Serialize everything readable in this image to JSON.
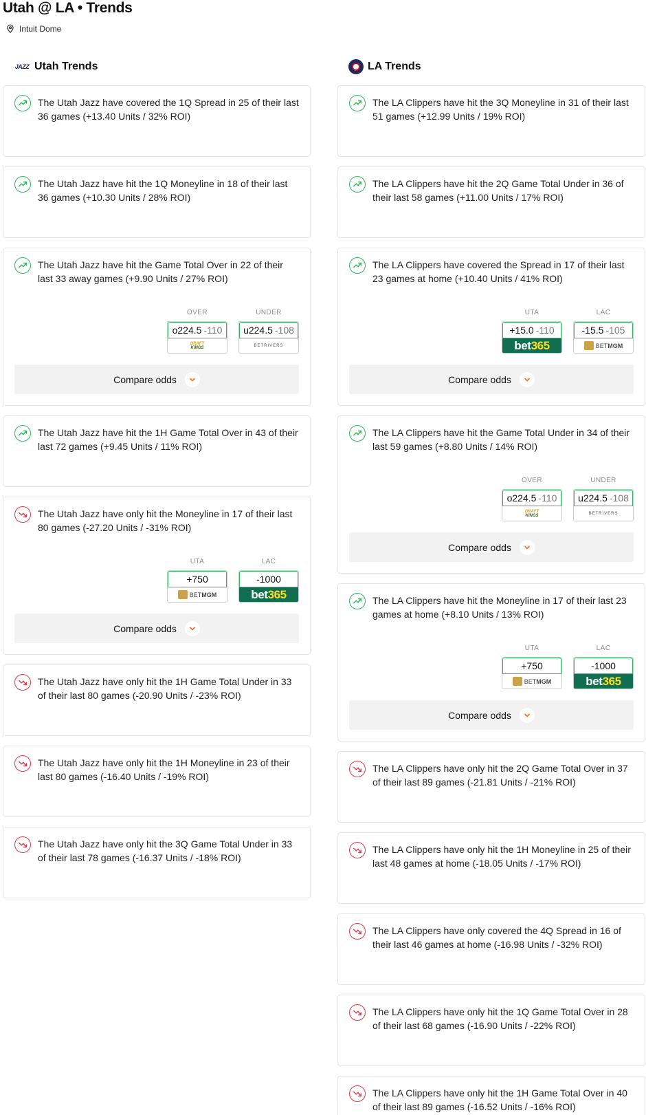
{
  "header": {
    "title": "Utah @ LA • Trends",
    "venue": "Intuit Dome",
    "venue_icon": "location-pin-icon"
  },
  "colors": {
    "up": "#2fb660",
    "down": "#e0394a",
    "accent": "#f26b21"
  },
  "compare_label": "Compare odds",
  "utah": {
    "heading": "Utah Trends",
    "logo_text": "JAZZ",
    "cards": [
      {
        "dir": "up",
        "text": "The Utah Jazz have covered the 1Q Spread in 25 of their last 36 games (+13.40 Units / 32% ROI)"
      },
      {
        "dir": "up",
        "text": "The Utah Jazz have hit the 1Q Moneyline in 18 of their last 36 games (+10.30 Units / 28% ROI)"
      },
      {
        "dir": "up",
        "text": "The Utah Jazz have hit the Game Total Over in 22 of their last 33 away games (+9.90 Units / 27% ROI)",
        "odds": [
          {
            "label": "OVER",
            "line": "o224.5",
            "price": "-110",
            "book": "DraftKings"
          },
          {
            "label": "UNDER",
            "line": "u224.5",
            "price": "-108",
            "book": "BetRivers"
          }
        ]
      },
      {
        "dir": "up",
        "text": "The Utah Jazz have hit the 1H Game Total Over in 43 of their last 72 games (+9.45 Units / 11% ROI)"
      },
      {
        "dir": "down",
        "text": "The Utah Jazz have only hit the Moneyline in 17 of their last 80 games (-27.20 Units / -31% ROI)",
        "odds": [
          {
            "label": "UTA",
            "line": "+750",
            "price": "",
            "book": "BetMGM"
          },
          {
            "label": "LAC",
            "line": "-1000",
            "price": "",
            "book": "bet365"
          }
        ]
      },
      {
        "dir": "down",
        "text": "The Utah Jazz have only hit the 1H Game Total Under in 33 of their last 80 games (-20.90 Units / -23% ROI)"
      },
      {
        "dir": "down",
        "text": "The Utah Jazz have only hit the 1H Moneyline in 23 of their last 80 games (-16.40 Units / -19% ROI)"
      },
      {
        "dir": "down",
        "text": "The Utah Jazz have only hit the 3Q Game Total Under in 33 of their last 78 games (-16.37 Units / -18% ROI)"
      }
    ]
  },
  "la": {
    "heading": "LA Trends",
    "cards": [
      {
        "dir": "up",
        "text": "The LA Clippers have hit the 3Q Moneyline in 31 of their last 51 games (+12.99 Units / 19% ROI)"
      },
      {
        "dir": "up",
        "text": "The LA Clippers have hit the 2Q Game Total Under in 36 of their last 58 games (+11.00 Units / 17% ROI)"
      },
      {
        "dir": "up",
        "text": "The LA Clippers have covered the Spread in 17 of their last 23 games at home (+10.40 Units / 41% ROI)",
        "odds": [
          {
            "label": "UTA",
            "line": "+15.0",
            "price": "-110",
            "book": "bet365"
          },
          {
            "label": "LAC",
            "line": "-15.5",
            "price": "-105",
            "book": "BetMGM"
          }
        ]
      },
      {
        "dir": "up",
        "text": "The LA Clippers have hit the Game Total Under in 34 of their last 59 games (+8.80 Units / 14% ROI)",
        "odds": [
          {
            "label": "OVER",
            "line": "o224.5",
            "price": "-110",
            "book": "DraftKings"
          },
          {
            "label": "UNDER",
            "line": "u224.5",
            "price": "-108",
            "book": "BetRivers"
          }
        ]
      },
      {
        "dir": "up",
        "text": "The LA Clippers have hit the Moneyline in 17 of their last 23 games at home (+8.10 Units / 13% ROI)",
        "odds": [
          {
            "label": "UTA",
            "line": "+750",
            "price": "",
            "book": "BetMGM"
          },
          {
            "label": "LAC",
            "line": "-1000",
            "price": "",
            "book": "bet365"
          }
        ]
      },
      {
        "dir": "down",
        "text": "The LA Clippers have only hit the 2Q Game Total Over in 37 of their last 89 games (-21.81 Units / -21% ROI)"
      },
      {
        "dir": "down",
        "text": "The LA Clippers have only hit the 1H Moneyline in 25 of their last 48 games at home (-18.05 Units / -17% ROI)"
      },
      {
        "dir": "down",
        "text": "The LA Clippers have only covered the 4Q Spread in 16 of their last 46 games at home (-16.98 Units / -32% ROI)"
      },
      {
        "dir": "down",
        "text": "The LA Clippers have only hit the 1Q Game Total Over in 28 of their last 68 games (-16.90 Units / -22% ROI)"
      },
      {
        "dir": "down",
        "text": "The LA Clippers have only hit the 1H Game Total Over in 40 of their last 89 games (-16.52 Units / -16% ROI)"
      }
    ]
  }
}
